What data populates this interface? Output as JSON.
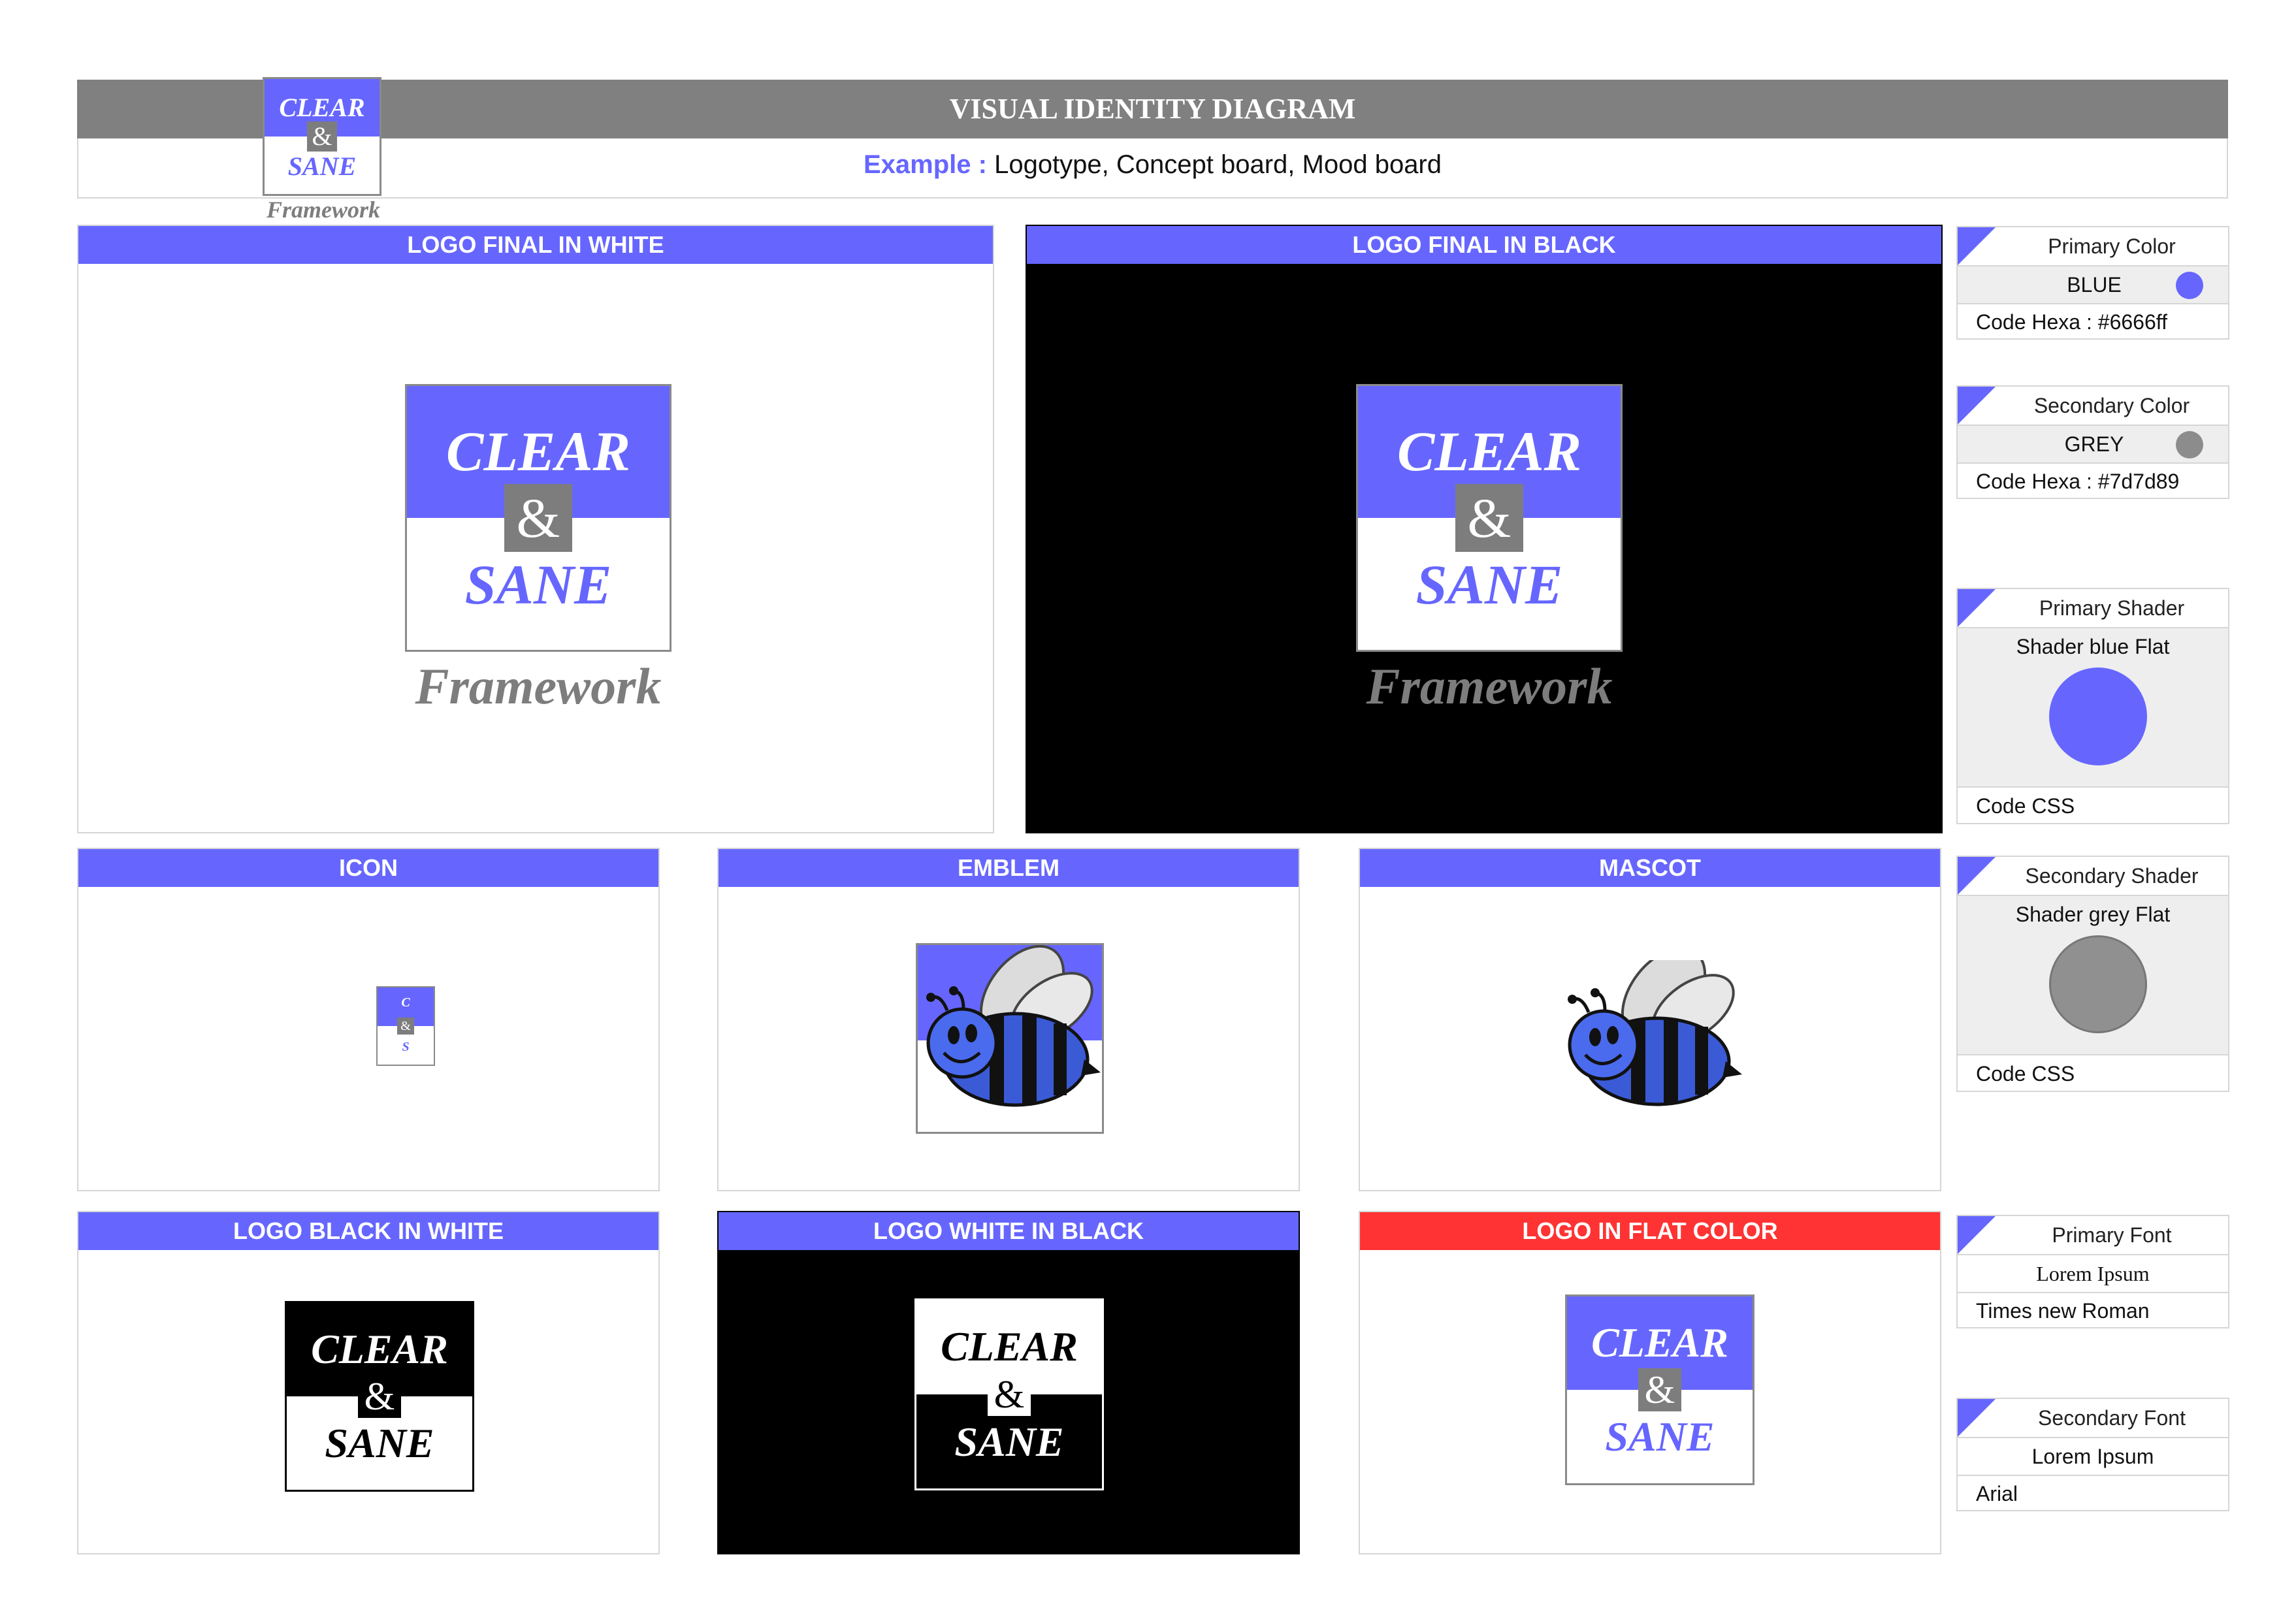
{
  "header": {
    "title": "VISUAL IDENTITY DIAGRAM",
    "example_label": "Example :",
    "example_text": "Logotype, Concept board, Mood board"
  },
  "logo": {
    "word1": "CLEAR",
    "amp": "&",
    "word2": "SANE",
    "tagline": "Framework",
    "icon_c": "C",
    "icon_s": "S"
  },
  "panels": {
    "logo_white": "LOGO FINAL IN WHITE",
    "logo_black": "LOGO FINAL IN BLACK",
    "icon": "ICON",
    "emblem": "EMBLEM",
    "mascot": "MASCOT",
    "black_in_white": "LOGO BLACK IN WHITE",
    "white_in_black": "LOGO WHITE IN BLACK",
    "flat_color": "LOGO IN FLAT COLOR"
  },
  "side": {
    "primary_color": {
      "title": "Primary Color",
      "name": "BLUE",
      "code": "Code Hexa : #6666ff",
      "swatch": "#6666ff"
    },
    "secondary_color": {
      "title": "Secondary Color",
      "name": "GREY",
      "code": "Code Hexa : #7d7d89",
      "swatch": "#8c8c8c"
    },
    "primary_shader": {
      "title": "Primary Shader",
      "label": "Shader blue Flat",
      "code": "Code CSS"
    },
    "secondary_shader": {
      "title": "Secondary Shader",
      "label": "Shader grey Flat",
      "code": "Code CSS"
    },
    "primary_font": {
      "title": "Primary Font",
      "sample": "Lorem Ipsum",
      "name": "Times new Roman"
    },
    "secondary_font": {
      "title": "Secondary Font",
      "sample": "Lorem Ipsum",
      "name": "Arial"
    }
  },
  "colors": {
    "brand": "#6666ff",
    "grey": "#808080",
    "red": "#ff3333"
  }
}
